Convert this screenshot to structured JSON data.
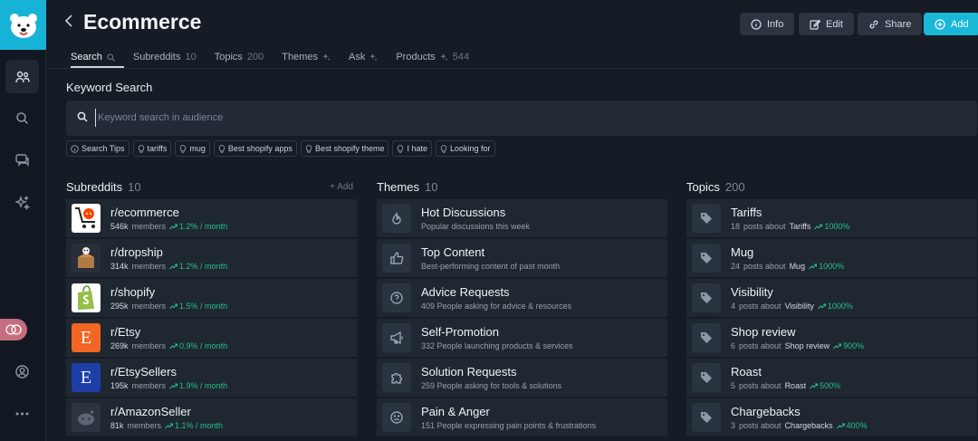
{
  "app": {
    "title": "Ecommerce"
  },
  "header_buttons": {
    "info": "Info",
    "edit": "Edit",
    "share": "Share",
    "add": "Add"
  },
  "tabs": [
    {
      "label": "Search",
      "count": ""
    },
    {
      "label": "Subreddits",
      "count": "10"
    },
    {
      "label": "Topics",
      "count": "200"
    },
    {
      "label": "Themes",
      "count": ""
    },
    {
      "label": "Ask",
      "count": ""
    },
    {
      "label": "Products",
      "count": "544"
    }
  ],
  "keyword_search": {
    "title": "Keyword Search",
    "placeholder": "Keyword search in audience",
    "chips": [
      "Search Tips",
      "tariffs",
      "mug",
      "Best shopify apps",
      "Best shopify theme",
      "I hate",
      "Looking for"
    ]
  },
  "subreddits": {
    "title": "Subreddits",
    "count": "10",
    "add_label": "+ Add",
    "items": [
      {
        "name": "r/ecommerce",
        "members": "546k",
        "members_label": "members",
        "growth": "1.2% / month",
        "thumb_color": "#ffffff",
        "thumb_glyph": ""
      },
      {
        "name": "r/dropship",
        "members": "314k",
        "members_label": "members",
        "growth": "1.2% / month",
        "thumb_color": "#2a2f37",
        "thumb_glyph": ""
      },
      {
        "name": "r/shopify",
        "members": "295k",
        "members_label": "members",
        "growth": "1.5% / month",
        "thumb_color": "#ffffff",
        "thumb_glyph": ""
      },
      {
        "name": "r/Etsy",
        "members": "269k",
        "members_label": "members",
        "growth": "0.9% / month",
        "thumb_color": "#f26522",
        "thumb_glyph": "E"
      },
      {
        "name": "r/EtsySellers",
        "members": "195k",
        "members_label": "members",
        "growth": "1.9% / month",
        "thumb_color": "#1f3fa8",
        "thumb_glyph": "E"
      },
      {
        "name": "r/AmazonSeller",
        "members": "81k",
        "members_label": "members",
        "growth": "1.1% / month",
        "thumb_color": "#2d3440",
        "thumb_glyph": ""
      }
    ]
  },
  "themes": {
    "title": "Themes",
    "count": "10",
    "items": [
      {
        "name": "Hot Discussions",
        "desc": "Popular discussions this week",
        "icon": "fire-icon"
      },
      {
        "name": "Top Content",
        "desc": "Best-performing content of past month",
        "icon": "thumbs-up-icon"
      },
      {
        "name": "Advice Requests",
        "desc": "409 People asking for advice & resources",
        "icon": "question-icon"
      },
      {
        "name": "Self-Promotion",
        "desc": "332 People launching products & services",
        "icon": "megaphone-icon"
      },
      {
        "name": "Solution Requests",
        "desc": "259 People asking for tools & solutions",
        "icon": "puzzle-icon"
      },
      {
        "name": "Pain & Anger",
        "desc": "151 People expressing pain points & frustrations",
        "icon": "frown-icon"
      }
    ]
  },
  "topics": {
    "title": "Topics",
    "count": "200",
    "items": [
      {
        "name": "Tariffs",
        "posts": "18",
        "posts_label": "posts about",
        "tag": "Tariffs",
        "growth": "1000%"
      },
      {
        "name": "Mug",
        "posts": "24",
        "posts_label": "posts about",
        "tag": "Mug",
        "growth": "1000%"
      },
      {
        "name": "Visibility",
        "posts": "4",
        "posts_label": "posts about",
        "tag": "Visibility",
        "growth": "1000%"
      },
      {
        "name": "Shop review",
        "posts": "6",
        "posts_label": "posts about",
        "tag": "Shop review",
        "growth": "900%"
      },
      {
        "name": "Roast",
        "posts": "5",
        "posts_label": "posts about",
        "tag": "Roast",
        "growth": "500%"
      },
      {
        "name": "Chargebacks",
        "posts": "3",
        "posts_label": "posts about",
        "tag": "Chargebacks",
        "growth": "400%"
      }
    ]
  },
  "colors": {
    "accent": "#19b7d8",
    "growth": "#23c08a",
    "panel": "#1f2731",
    "background": "#151c26"
  }
}
